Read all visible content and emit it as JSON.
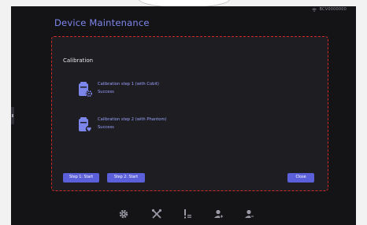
{
  "status_bar": {
    "device_id": "BCV0000000",
    "icon": "wifi-icon"
  },
  "page": {
    "title": "Device Maintenance"
  },
  "calibration": {
    "section_title": "Calibration",
    "steps": [
      {
        "name": "Calibration step 1 (with Cobit)",
        "status": "Success",
        "icon": "calibration-gear-icon"
      },
      {
        "name": "Calibration step 2 (with Phantom)",
        "status": "Success",
        "icon": "calibration-heart-icon"
      }
    ],
    "buttons": {
      "step1_start": "Step 1: Start",
      "step2_start": "Step 2: Start",
      "close": "Close"
    }
  },
  "bottom_nav": [
    {
      "name": "settings",
      "icon": "gear-icon"
    },
    {
      "name": "tools",
      "icon": "wrench-icon"
    },
    {
      "name": "alerts",
      "icon": "list-alert-icon"
    },
    {
      "name": "add-user",
      "icon": "user-add-icon"
    },
    {
      "name": "remove-user",
      "icon": "user-remove-icon"
    }
  ],
  "colors": {
    "accent": "#5b5fd9",
    "title": "#7f87ee",
    "highlight_border": "#d22828",
    "background": "#141417",
    "card": "#1e1e22"
  }
}
